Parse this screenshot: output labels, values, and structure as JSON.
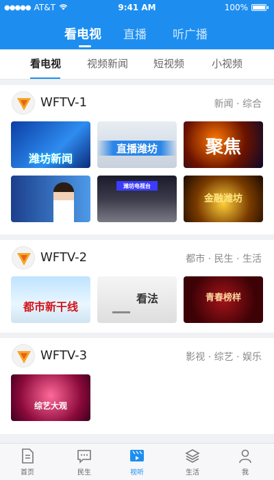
{
  "status_bar": {
    "carrier": "AT&T",
    "time": "9:41 AM",
    "battery": "100%"
  },
  "top_tabs": [
    {
      "label": "看电视",
      "active": true
    },
    {
      "label": "直播",
      "active": false
    },
    {
      "label": "听广播",
      "active": false
    }
  ],
  "sub_tabs": [
    {
      "label": "看电视",
      "active": true
    },
    {
      "label": "视频新闻",
      "active": false
    },
    {
      "label": "短视频",
      "active": false
    },
    {
      "label": "小视频",
      "active": false
    }
  ],
  "channels": [
    {
      "name": "WFTV-1",
      "tags": "新闻 · 综合",
      "thumbnails": [
        {
          "caption": "潍坊新闻"
        },
        {
          "caption": "直播潍坊"
        },
        {
          "caption": "聚焦"
        },
        {
          "caption": ""
        },
        {
          "caption": "潍坊电视台"
        },
        {
          "caption": "金融潍坊"
        }
      ]
    },
    {
      "name": "WFTV-2",
      "tags": "都市 · 民生 · 生活",
      "thumbnails": [
        {
          "caption": "都市新干线"
        },
        {
          "caption": "看法"
        },
        {
          "caption": "青春榜样"
        }
      ]
    },
    {
      "name": "WFTV-3",
      "tags": "影视 · 综艺 · 娱乐",
      "thumbnails": [
        {
          "caption": "综艺大观"
        }
      ]
    }
  ],
  "bottom_nav": [
    {
      "label": "首页",
      "icon": "document-icon",
      "active": false
    },
    {
      "label": "民生",
      "icon": "chat-icon",
      "active": false
    },
    {
      "label": "视听",
      "icon": "video-icon",
      "active": true
    },
    {
      "label": "生活",
      "icon": "layers-icon",
      "active": false
    },
    {
      "label": "我",
      "icon": "user-icon",
      "active": false
    }
  ],
  "colors": {
    "brand_blue": "#1d8ef0",
    "text_dark": "#222222",
    "text_gray": "#888888"
  }
}
